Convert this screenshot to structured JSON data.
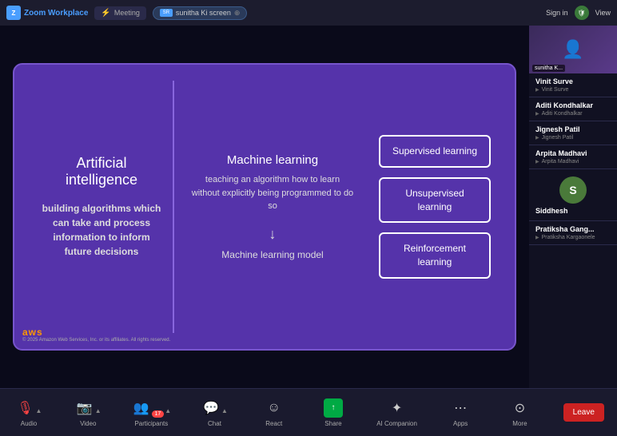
{
  "app": {
    "name": "Zoom Workplace",
    "tab": "Meeting",
    "screen_share": "sunitha Ki screen",
    "sign_in": "Sign in",
    "view_label": "View"
  },
  "toolbar": {
    "audio_label": "Audio",
    "video_label": "Video",
    "participants_label": "Participants",
    "participants_count": "17",
    "chat_label": "Chat",
    "react_label": "React",
    "share_label": "Share",
    "ai_companion_label": "AI Companion",
    "apps_label": "Apps",
    "more_label": "More",
    "leave_label": "Leave"
  },
  "slide": {
    "ai_title": "Artificial intelligence",
    "ai_desc": "building algorithms which can take and process information to inform future decisions",
    "ml_title": "Machine learning",
    "ml_desc": "teaching an algorithm how to learn without explicitly being programmed to do so",
    "ml_model": "Machine learning model",
    "supervised": "Supervised learning",
    "unsupervised": "Unsupervised learning",
    "reinforcement": "Reinforcement learning",
    "aws_logo": "aws",
    "aws_copyright": "© 2025 Amazon Web Services, Inc. or its affiliates. All rights reserved."
  },
  "participants": [
    {
      "name": "Vinit Surve",
      "subname": "Vinit Surve",
      "type": "video"
    },
    {
      "name": "Aditi Kondhalkar",
      "subname": "Aditi Kondhalkar",
      "type": "text"
    },
    {
      "name": "Jignesh Patil",
      "subname": "Jignesh Patil",
      "type": "text"
    },
    {
      "name": "Arpita Madhavi",
      "subname": "Arpita Madhavi",
      "type": "text"
    },
    {
      "name": "Siddhesh",
      "subname": "Siddhesh",
      "initial": "S",
      "type": "avatar"
    },
    {
      "name": "Pratiksha Gang...",
      "subname": "Pratiksha Kargaonele",
      "type": "text"
    }
  ]
}
